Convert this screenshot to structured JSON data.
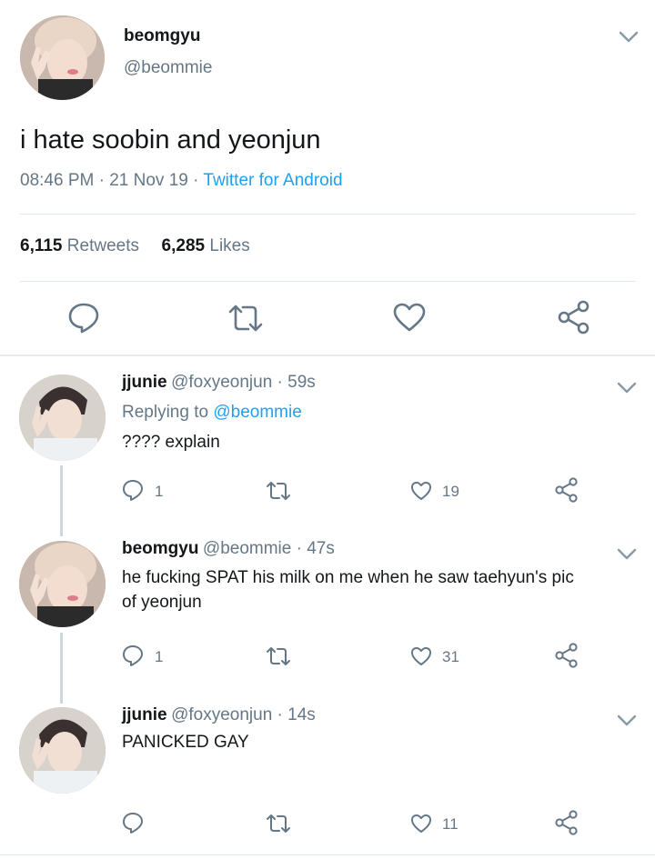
{
  "main_tweet": {
    "name": "beomgyu",
    "handle": "@beommie",
    "text": "i hate soobin and yeonjun",
    "time": "08:46 PM",
    "dot1": "·",
    "date": "21 Nov 19",
    "dot2": "·",
    "source": "Twitter for Android",
    "retweets_count": "6,115",
    "retweets_label": "Retweets",
    "likes_count": "6,285",
    "likes_label": "Likes"
  },
  "replies": [
    {
      "name": "jjunie",
      "handle_time": "@foxyeonjun · 59s",
      "replying_prefix": "Replying to",
      "replying_to": "@beommie",
      "text": "???? explain",
      "reply_count": "1",
      "retweet_count": "",
      "like_count": "19"
    },
    {
      "name": "beomgyu",
      "handle_time": "@beommie · 47s",
      "text_line1": "he fucking SPAT his milk on me when he saw taehyun's pic",
      "text_line2": "of yeonjun",
      "reply_count": "1",
      "retweet_count": "",
      "like_count": "31"
    },
    {
      "name": "jjunie",
      "handle_time": "@foxyeonjun · 14s",
      "text": "PANICKED GAY",
      "reply_count": "",
      "retweet_count": "",
      "like_count": "11"
    }
  ],
  "colors": {
    "primary_text": "#14171a",
    "secondary_text": "#657786",
    "link": "#1da1f2",
    "icon": "#657786",
    "separator": "#e1e8ed"
  },
  "icons": [
    "chevron-down-icon",
    "reply-icon",
    "retweet-icon",
    "like-icon",
    "share-icon"
  ]
}
